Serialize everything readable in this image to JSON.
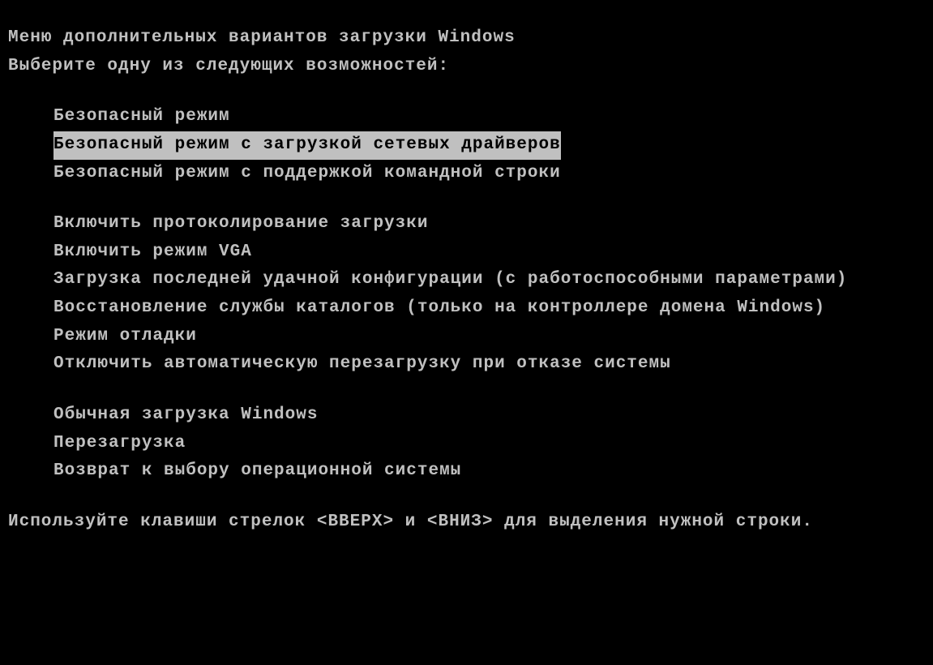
{
  "header": {
    "title": "Меню дополнительных вариантов загрузки Windows",
    "subtitle": "Выберите одну из следующих возможностей:"
  },
  "menu": {
    "group1": [
      {
        "label": "Безопасный режим",
        "selected": false
      },
      {
        "label": "Безопасный режим с загрузкой сетевых драйверов",
        "selected": true
      },
      {
        "label": "Безопасный режим с поддержкой командной строки",
        "selected": false
      }
    ],
    "group2": [
      {
        "label": "Включить протоколирование загрузки",
        "selected": false
      },
      {
        "label": "Включить режим VGA",
        "selected": false
      },
      {
        "label": "Загрузка последней удачной конфигурации (с работоспособными параметрами)",
        "selected": false
      },
      {
        "label": "Восстановление службы каталогов (только на контроллере домена Windows)",
        "selected": false
      },
      {
        "label": "Режим отладки",
        "selected": false
      },
      {
        "label": "Отключить автоматическую перезагрузку при отказе системы",
        "selected": false
      }
    ],
    "group3": [
      {
        "label": "Обычная загрузка Windows",
        "selected": false
      },
      {
        "label": "Перезагрузка",
        "selected": false
      },
      {
        "label": "Возврат к выбору операционной системы",
        "selected": false
      }
    ]
  },
  "footer": {
    "hint": "Используйте клавиши стрелок <ВВЕРХ> и <ВНИЗ> для выделения нужной строки."
  }
}
